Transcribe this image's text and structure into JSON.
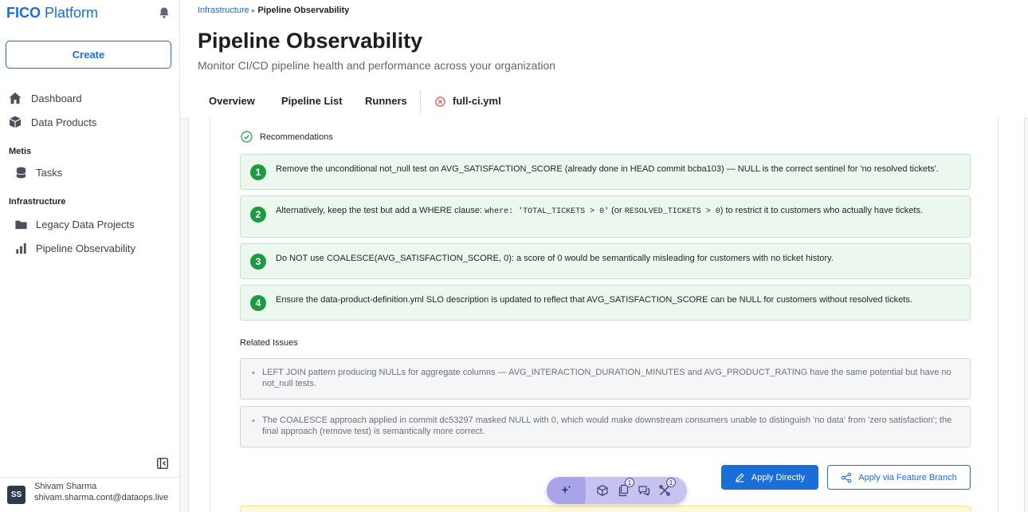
{
  "app": {
    "brand_bold": "FICO",
    "brand_rest": " Platform",
    "create_label": "Create"
  },
  "sidebar": {
    "items_top": [
      {
        "label": "Dashboard",
        "icon": "home-icon"
      },
      {
        "label": "Data Products",
        "icon": "cube-icon"
      }
    ],
    "section_metis": "Metis",
    "metis_items": [
      {
        "label": "Tasks",
        "icon": "database-icon"
      }
    ],
    "section_infra": "Infrastructure",
    "infra_items": [
      {
        "label": "Legacy Data Projects",
        "icon": "folder-icon"
      },
      {
        "label": "Pipeline Observability",
        "icon": "bar-chart-icon"
      }
    ],
    "user": {
      "initials": "SS",
      "name": "Shivam Sharma",
      "email": "shivam.sharma.cont@dataops.live"
    }
  },
  "header": {
    "breadcrumb_parent": "Infrastructure",
    "breadcrumb_sep": "▸",
    "breadcrumb_current": "Pipeline Observability",
    "title": "Pipeline Observability",
    "subtitle": "Monitor CI/CD pipeline health and performance across your organization"
  },
  "tabs": {
    "overview": "Overview",
    "pipeline_list": "Pipeline List",
    "runners": "Runners",
    "active": "full-ci.yml"
  },
  "recommendations": {
    "heading": "Recommendations",
    "items": [
      {
        "num": "1",
        "text": "Remove the unconditional not_null test on AVG_SATISFACTION_SCORE (already done in HEAD commit bcba103) — NULL is the correct sentinel for 'no resolved tickets'."
      },
      {
        "num": "2",
        "pre": "Alternatively, keep the test but add a WHERE clause: ",
        "code1": "where: 'TOTAL_TICKETS > 0'",
        "mid": " (or ",
        "code2": "RESOLVED_TICKETS > 0",
        "post": ") to restrict it to customers who actually have tickets."
      },
      {
        "num": "3",
        "text": "Do NOT use COALESCE(AVG_SATISFACTION_SCORE, 0): a score of 0 would be semantically misleading for customers with no ticket history."
      },
      {
        "num": "4",
        "text": "Ensure the data-product-definition.yml SLO description is updated to reflect that AVG_SATISFACTION_SCORE can be NULL for customers without resolved tickets."
      }
    ]
  },
  "related": {
    "heading": "Related Issues",
    "bullet": "•",
    "items": [
      {
        "text": "LEFT JOIN pattern producing NULLs for aggregate columns — AVG_INTERACTION_DURATION_MINUTES and AVG_PRODUCT_RATING have the same potential but have no not_null tests."
      },
      {
        "text": "The COALESCE approach applied in commit dc53297 masked NULL with 0, which would make downstream consumers unable to distinguish 'no data' from 'zero satisfaction'; the final approach (remove test) is semantically more correct."
      }
    ]
  },
  "actions": {
    "apply_directly": "Apply Directly",
    "apply_branch": "Apply via Feature Branch"
  },
  "floating_toolbar": {
    "badge_1": "1",
    "badge_2": "1"
  },
  "colors": {
    "accent": "#1a6ed8",
    "success": "#1e9a45",
    "success_bg": "#ecf8ee"
  }
}
